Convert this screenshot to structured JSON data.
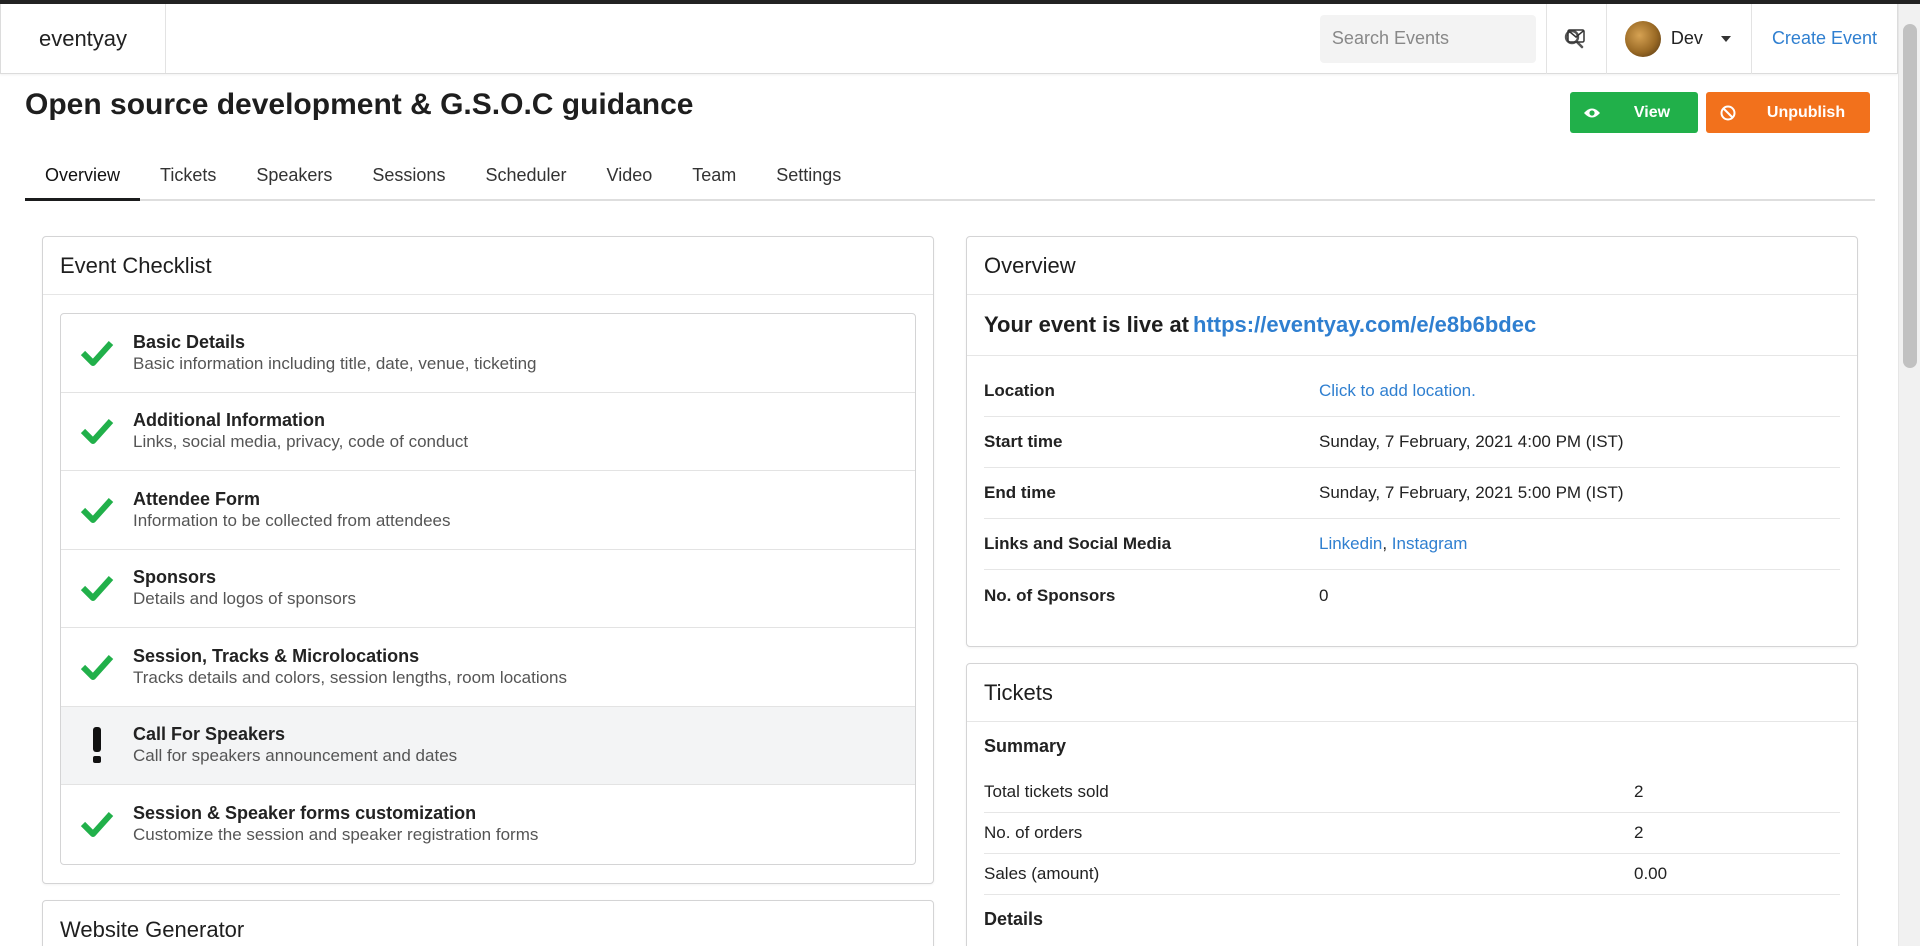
{
  "navbar": {
    "brand": "eventyay",
    "search_placeholder": "Search Events",
    "user_name": "Dev",
    "create_event": "Create Event"
  },
  "page": {
    "title": "Open source development & G.S.O.C guidance",
    "view_label": "View",
    "unpublish_label": "Unpublish"
  },
  "colors": {
    "view": "#21b04a",
    "unpublish": "#f2711c",
    "link": "#2f7fd0",
    "check": "#21b04a"
  },
  "tabs": [
    {
      "label": "Overview"
    },
    {
      "label": "Tickets"
    },
    {
      "label": "Speakers"
    },
    {
      "label": "Sessions"
    },
    {
      "label": "Scheduler"
    },
    {
      "label": "Video"
    },
    {
      "label": "Team"
    },
    {
      "label": "Settings"
    }
  ],
  "checklist": {
    "title": "Event Checklist",
    "items": [
      {
        "title": "Basic Details",
        "sub": "Basic information including title, date, venue, ticketing",
        "status": "done"
      },
      {
        "title": "Additional Information",
        "sub": "Links, social media, privacy, code of conduct",
        "status": "done"
      },
      {
        "title": "Attendee Form",
        "sub": "Information to be collected from attendees",
        "status": "done"
      },
      {
        "title": "Sponsors",
        "sub": "Details and logos of sponsors",
        "status": "done"
      },
      {
        "title": "Session, Tracks & Microlocations",
        "sub": "Tracks details and colors, session lengths, room locations",
        "status": "done"
      },
      {
        "title": "Call For Speakers",
        "sub": "Call for speakers announcement and dates",
        "status": "pending"
      },
      {
        "title": "Session & Speaker forms customization",
        "sub": "Customize the session and speaker registration forms",
        "status": "done"
      }
    ]
  },
  "website_generator": {
    "title": "Website Generator"
  },
  "overview": {
    "title": "Overview",
    "live_prefix": "Your event is live at",
    "live_url": "https://eventyay.com/e/e8b6bdec",
    "rows": {
      "location_key": "Location",
      "location_val": "Click to add location.",
      "start_key": "Start time",
      "start_val": "Sunday, 7 February, 2021 4:00 PM (IST)",
      "end_key": "End time",
      "end_val": "Sunday, 7 February, 2021 5:00 PM (IST)",
      "links_key": "Links and Social Media",
      "link_1": "Linkedin",
      "link_sep": ",",
      "link_2": "Instagram",
      "sponsors_key": "No. of Sponsors",
      "sponsors_val": "0"
    }
  },
  "tickets": {
    "title": "Tickets",
    "summary": "Summary",
    "rows": [
      {
        "key": "Total tickets sold",
        "val": "2"
      },
      {
        "key": "No. of orders",
        "val": "2"
      },
      {
        "key": "Sales (amount)",
        "val": "0.00"
      }
    ],
    "details": "Details"
  }
}
